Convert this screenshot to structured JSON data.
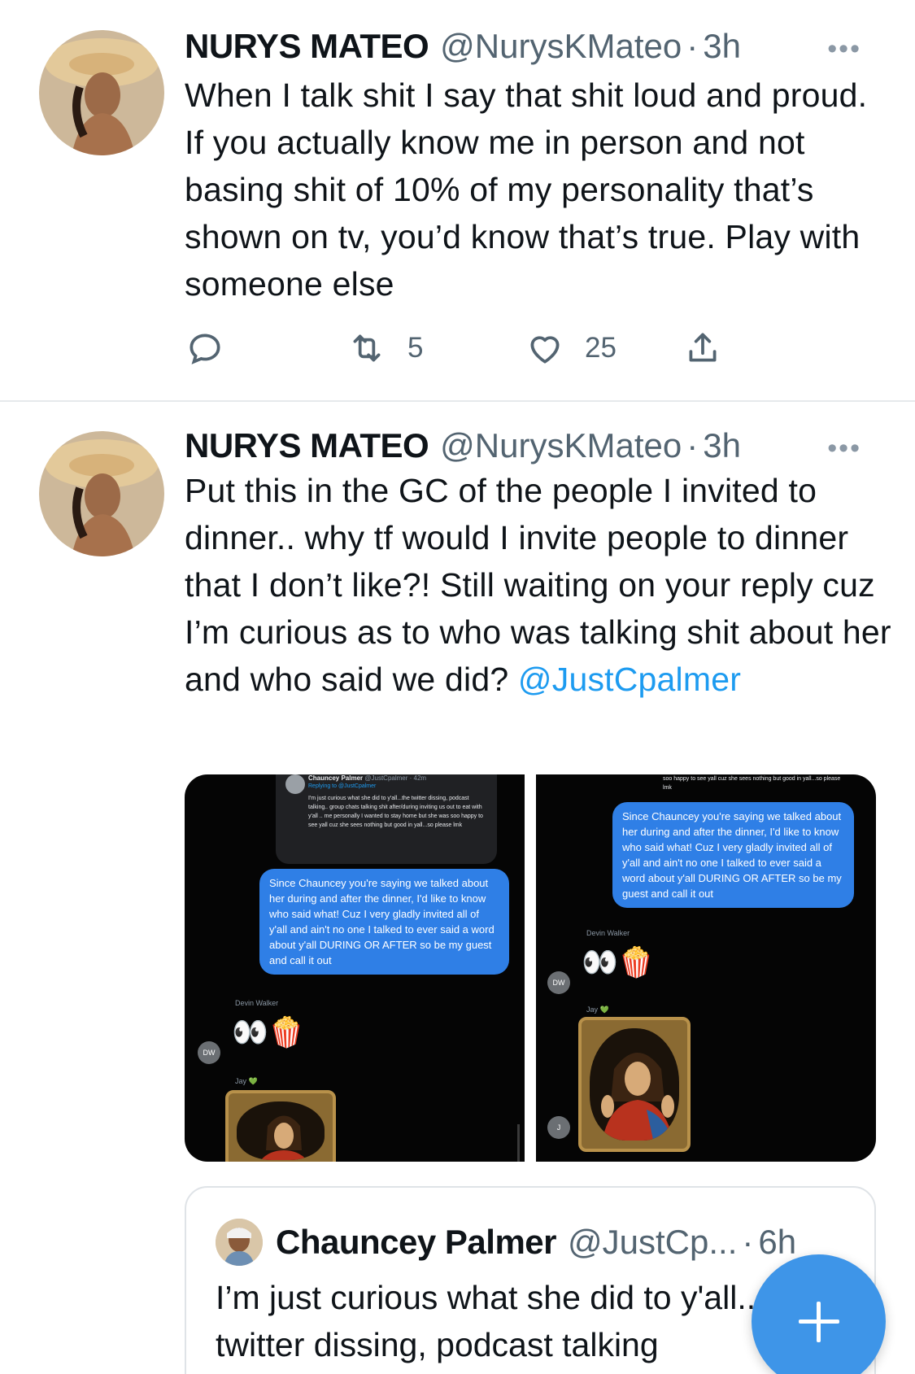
{
  "tweets": [
    {
      "name": "NURYS MATEO",
      "handle": "@NurysKMateo",
      "separator": "·",
      "time": "3h",
      "more": "•••",
      "text": "When I talk shit I say that shit loud and proud. If you actually know me in person and not basing shit of 10% of my personality that’s shown on tv, you’d know that’s true. Play with someone else",
      "actions": {
        "reply_icon": "reply-icon",
        "retweet_icon": "retweet-icon",
        "retweet_count": "5",
        "like_icon": "heart-icon",
        "like_count": "25",
        "share_icon": "share-icon"
      }
    },
    {
      "name": "NURYS MATEO",
      "handle": "@NurysKMateo",
      "separator": "·",
      "time": "3h",
      "more": "•••",
      "text": "Put this in the GC of the people I invited to dinner.. why tf would I invite people to dinner that I don’t like?! Still waiting on your reply cuz I’m curious as to who was talking shit about her and who said we did? ",
      "mention": "@JustCpalmer",
      "media": [
        {
          "header_name": "Chauncey Palmer",
          "header_handle": "@JustCpalmer · 42m",
          "header_reply": "Replying to @JustCpalmer",
          "header_text": "I'm just curious what she did to y'all...the twitter dissing, podcast talking.. group chats talking shit after/during inviting us out to eat with y'all .. me personally I wanted to stay home but she was soo happy to see yall cuz she sees nothing but good in yall...so please lmk",
          "bubble": "Since Chauncey you're saying we talked about her during and after the dinner, I'd like to know who said what! Cuz I very gladly invited all of y'all and ain't no one I talked to ever said a word about y'all DURING OR AFTER so be my guest and call it out",
          "sender": "Devin Walker",
          "sender_initials": "DW",
          "emoji": "👀🍿",
          "next_sender": "Jay 💚"
        },
        {
          "header_text": "soo happy to see yall cuz she sees nothing but good in yall...so please lmk",
          "bubble": "Since Chauncey you're saying we talked about her during and after the dinner, I'd like to know who said what! Cuz I very gladly invited all of y'all and ain't no one I talked to ever said a word about y'all DURING OR AFTER so be my guest and call it out",
          "sender": "Devin Walker",
          "sender_initials": "DW",
          "emoji": "👀🍿",
          "next_sender": "Jay 💚",
          "next_initial": "J"
        }
      ],
      "quote": {
        "name": "Chauncey Palmer",
        "handle": "@JustCp...",
        "separator": "·",
        "time": "6h",
        "text": "I’m just curious what she did to y'all... the twitter dissing, podcast talking"
      }
    }
  ],
  "fab": {
    "icon": "compose-plus-icon"
  },
  "colors": {
    "link": "#1d9bf0",
    "secondary": "#536471",
    "fab": "#3e95e8"
  }
}
